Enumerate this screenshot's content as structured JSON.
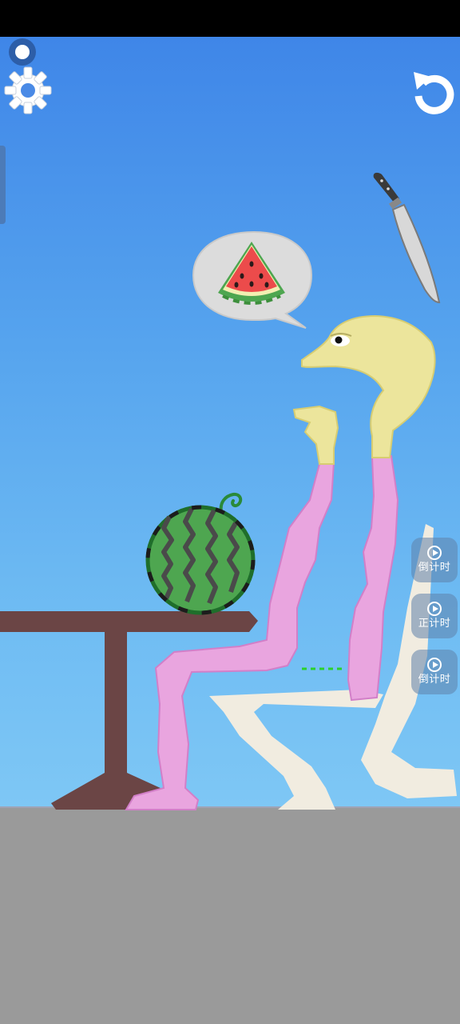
{
  "hud": {
    "record_icon": "record-dot-icon",
    "settings_icon": "gear-icon",
    "undo_icon": "undo-icon"
  },
  "timers": [
    {
      "label": "倒计时",
      "icon": "play-circle-icon"
    },
    {
      "label": "正计时",
      "icon": "play-circle-icon"
    },
    {
      "label": "倒计时",
      "icon": "play-circle-icon"
    }
  ],
  "scene": {
    "thought_bubble_icon": "watermelon-slice-icon",
    "objects": [
      "watermelon",
      "table",
      "knife",
      "pink-character",
      "chair"
    ]
  },
  "colors": {
    "sky_top": "#3f86e8",
    "sky_bottom": "#7ec7f5",
    "floor": "#9a9a9a",
    "character_body": "#e9a5df",
    "character_head": "#ece59c",
    "table": "#6b4545",
    "watermelon": "#4ea650",
    "chair": "#f1ece0"
  }
}
